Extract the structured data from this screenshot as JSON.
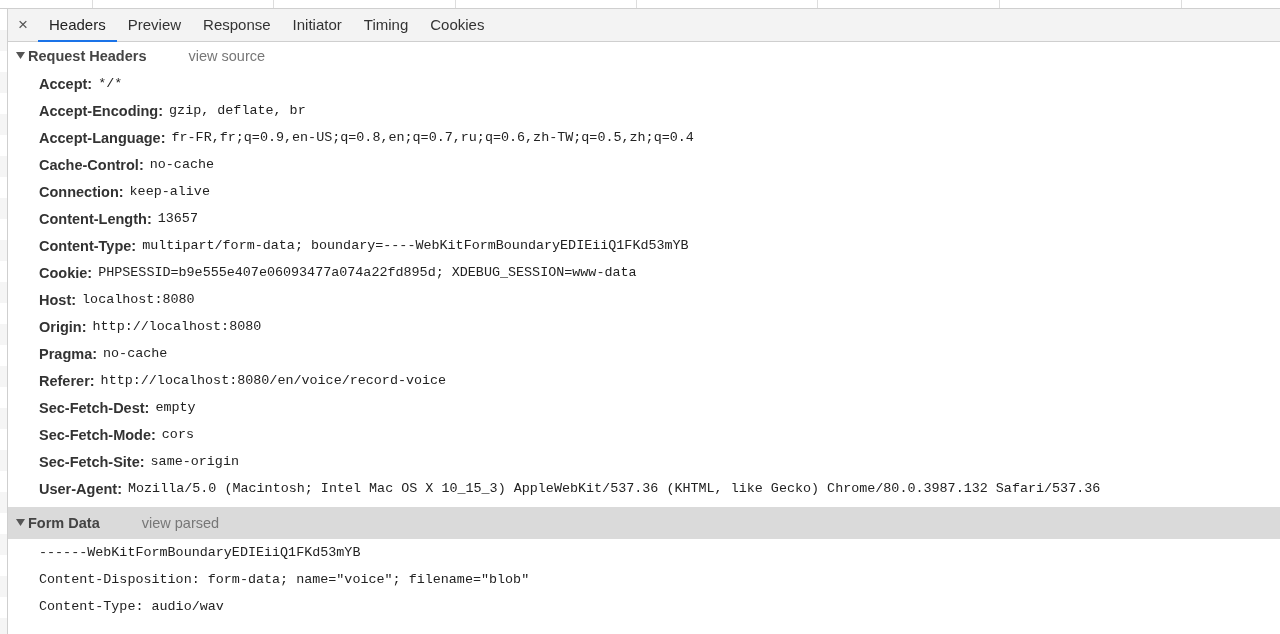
{
  "tabs": [
    {
      "label": "Headers",
      "selected": true
    },
    {
      "label": "Preview",
      "selected": false
    },
    {
      "label": "Response",
      "selected": false
    },
    {
      "label": "Initiator",
      "selected": false
    },
    {
      "label": "Timing",
      "selected": false
    },
    {
      "label": "Cookies",
      "selected": false
    }
  ],
  "close_icon": "×",
  "sections": [
    {
      "title": "Request Headers",
      "link": "view source",
      "expanded": true,
      "highlighted": false,
      "kind": "headers",
      "headers": [
        {
          "name": "Accept:",
          "value": "*/*"
        },
        {
          "name": "Accept-Encoding:",
          "value": "gzip, deflate, br"
        },
        {
          "name": "Accept-Language:",
          "value": "fr-FR,fr;q=0.9,en-US;q=0.8,en;q=0.7,ru;q=0.6,zh-TW;q=0.5,zh;q=0.4"
        },
        {
          "name": "Cache-Control:",
          "value": "no-cache"
        },
        {
          "name": "Connection:",
          "value": "keep-alive"
        },
        {
          "name": "Content-Length:",
          "value": "13657"
        },
        {
          "name": "Content-Type:",
          "value": "multipart/form-data; boundary=----WebKitFormBoundaryEDIEiiQ1FKd53mYB"
        },
        {
          "name": "Cookie:",
          "value": "PHPSESSID=b9e555e407e06093477a074a22fd895d; XDEBUG_SESSION=www-data"
        },
        {
          "name": "Host:",
          "value": "localhost:8080"
        },
        {
          "name": "Origin:",
          "value": "http://localhost:8080"
        },
        {
          "name": "Pragma:",
          "value": "no-cache"
        },
        {
          "name": "Referer:",
          "value": "http://localhost:8080/en/voice/record-voice"
        },
        {
          "name": "Sec-Fetch-Dest:",
          "value": "empty"
        },
        {
          "name": "Sec-Fetch-Mode:",
          "value": "cors"
        },
        {
          "name": "Sec-Fetch-Site:",
          "value": "same-origin"
        },
        {
          "name": "User-Agent:",
          "value": "Mozilla/5.0 (Macintosh; Intel Mac OS X 10_15_3) AppleWebKit/537.36 (KHTML, like Gecko) Chrome/80.0.3987.132 Safari/537.36"
        }
      ]
    },
    {
      "title": "Form Data",
      "link": "view parsed",
      "expanded": true,
      "highlighted": true,
      "kind": "source",
      "lines": [
        "------WebKitFormBoundaryEDIEiiQ1FKd53mYB",
        "Content-Disposition: form-data; name=\"voice\"; filename=\"blob\"",
        "Content-Type: audio/wav"
      ]
    }
  ]
}
